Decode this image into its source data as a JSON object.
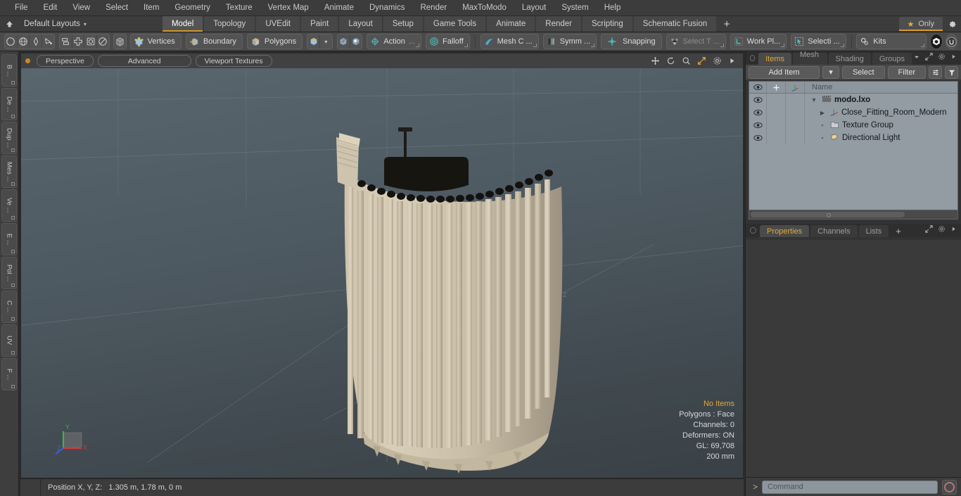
{
  "menubar": {
    "items": [
      "File",
      "Edit",
      "View",
      "Select",
      "Item",
      "Geometry",
      "Texture",
      "Vertex Map",
      "Animate",
      "Dynamics",
      "Render",
      "MaxToModo",
      "Layout",
      "System",
      "Help"
    ]
  },
  "layoutbar": {
    "home_icon": "home-up-icon",
    "layouts_label": "Default Layouts",
    "caret": "▾",
    "tabs": [
      {
        "label": "Model",
        "active": true
      },
      {
        "label": "Topology",
        "active": false
      },
      {
        "label": "UVEdit",
        "active": false
      },
      {
        "label": "Paint",
        "active": false
      },
      {
        "label": "Layout",
        "active": false
      },
      {
        "label": "Setup",
        "active": false
      },
      {
        "label": "Game Tools",
        "active": false
      },
      {
        "label": "Animate",
        "active": false
      },
      {
        "label": "Render",
        "active": false
      },
      {
        "label": "Scripting",
        "active": false
      },
      {
        "label": "Schematic Fusion",
        "active": false
      }
    ],
    "add_tab": "+",
    "only_star": "★",
    "only_label": "Only",
    "gear_icon": "gear-icon"
  },
  "toolbar": {
    "shape_group": [
      "circle-icon",
      "globe-icon",
      "pen-icon",
      "curve-icon"
    ],
    "mirror_group": [
      "mirror-icon",
      "align-icon",
      "center-icon",
      "radial-icon"
    ],
    "cube_button": "cube-icon",
    "selection_modes": [
      {
        "icon": "vertices-icon",
        "label": "Vertices"
      },
      {
        "icon": "boundary-icon",
        "label": "Boundary"
      },
      {
        "icon": "polygons-icon",
        "label": "Polygons"
      }
    ],
    "element_cube": "element-cube-icon",
    "element_caret": "▾",
    "axis_buttons": [
      "axis-cube-red-icon",
      "axis-cube-white-icon"
    ],
    "action": {
      "icon": "action-center-icon",
      "label": "Action",
      "ellipsis": "..."
    },
    "falloff": {
      "icon": "falloff-icon",
      "label": "Falloff"
    },
    "mesh_constraint": {
      "icon": "mesh-constraint-icon",
      "label": "Mesh C ..."
    },
    "symmetry": {
      "icon": "symmetry-icon",
      "label": "Symm ..."
    },
    "snapping": {
      "icon": "snapping-icon",
      "label": "Snapping"
    },
    "select_through": {
      "icon": "select-through-icon",
      "label": "Select T ...",
      "disabled": true
    },
    "work_plane": {
      "icon": "work-plane-icon",
      "label": "Work Pl..."
    },
    "selection_set": {
      "icon": "selection-icon",
      "label": "Selecti ..."
    },
    "kits": {
      "icon": "kits-gear-icon",
      "label": "Kits"
    },
    "app_icons": [
      "modo-logo-icon",
      "unreal-logo-icon"
    ]
  },
  "left_strip": {
    "tabs": [
      "B ...",
      "De ...",
      "Dup ...",
      "Mes ...",
      "Ve ...",
      "E ...",
      "Pol ...",
      "C ...",
      "UV",
      "F ..."
    ]
  },
  "viewport": {
    "header": {
      "dot_color": "#c98a22",
      "buttons": [
        "Perspective",
        "Advanced",
        "Viewport Textures"
      ],
      "icons": [
        "move-icon",
        "rotate-icon",
        "zoom-icon",
        "fit-icon",
        "gear-icon",
        "play-icon"
      ]
    },
    "info": {
      "no_items": "No Items",
      "polygons": "Polygons : Face",
      "channels": "Channels: 0",
      "deformers": "Deformers: ON",
      "gl": "GL: 69,708",
      "scale": "200 mm"
    },
    "axis_gizmo": {
      "x": "X",
      "y": "Y",
      "z": "Z",
      "x_color": "#cc3b3b",
      "y_color": "#3cb44a",
      "z_color": "#3b5fd4"
    },
    "model": {
      "name": "curtain-drapery-mesh",
      "material_color": "#cfc3ab",
      "rod_color": "#1d1b19",
      "panel_count": 26
    }
  },
  "statusbar": {
    "position_label": "Position X, Y, Z:",
    "position_value": "1.305 m, 1.78 m, 0 m"
  },
  "right_panel": {
    "top_tabs": [
      {
        "label": "Items",
        "active": true
      },
      {
        "label": "Mesh ...",
        "active": false
      },
      {
        "label": "Shading",
        "active": false
      },
      {
        "label": "Groups",
        "active": false
      }
    ],
    "top_tab_icons": [
      "chevron-down-icon",
      "expand-icon",
      "gear-icon",
      "play-icon"
    ],
    "tools": {
      "add_item": "Add Item",
      "add_item_caret": "▾",
      "select": "Select",
      "filter": "Filter",
      "list_icon": "list-options-icon",
      "funnel_icon": "funnel-icon"
    },
    "item_list": {
      "columns": [
        "eye-icon",
        "lock-icon",
        "axis-icon",
        "Name"
      ],
      "rows": [
        {
          "name": "modo.lxo",
          "icon": "scene-clapper-icon",
          "depth": 0,
          "root": true,
          "expander": "▾",
          "eye": true
        },
        {
          "name": "Close_Fitting_Room_Modern",
          "icon": "mesh-axis-icon",
          "depth": 1,
          "root": false,
          "expander": "▶",
          "eye": true
        },
        {
          "name": "Texture Group",
          "icon": "folder-icon",
          "depth": 1,
          "root": false,
          "expander": "",
          "eye": true
        },
        {
          "name": "Directional Light",
          "icon": "light-icon",
          "depth": 1,
          "root": false,
          "expander": "",
          "eye": true
        }
      ]
    },
    "bottom_tabs": [
      {
        "label": "Properties",
        "active": true
      },
      {
        "label": "Channels",
        "active": false
      },
      {
        "label": "Lists",
        "active": false
      },
      {
        "label": "+",
        "active": false
      }
    ],
    "bottom_tab_icons": [
      "expand-icon",
      "gear-icon",
      "play-icon"
    ]
  },
  "command_bar": {
    "prompt": "&gt;",
    "placeholder": "Command",
    "record_icon": "record-circle-icon"
  },
  "colors": {
    "accent_orange": "#e0a93b",
    "panel_bg": "#3c3c3c",
    "toolbar_bg": "#4a4a4a",
    "list_bg": "#939ba3",
    "viewport_top": "#5a666e",
    "viewport_bottom": "#394146"
  }
}
